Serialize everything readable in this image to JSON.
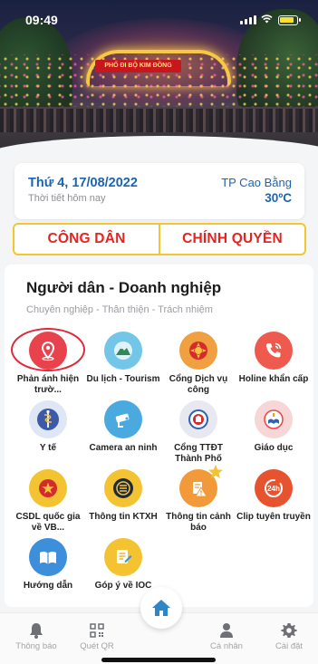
{
  "status_bar": {
    "time": "09:49"
  },
  "hero": {
    "sign_text": "PHỐ ĐI BỘ KIM ĐỒNG"
  },
  "weather": {
    "date": "Thứ 4, 17/08/2022",
    "subtitle": "Thời tiết hôm nay",
    "city": "TP Cao Bằng",
    "temperature": "30ºC"
  },
  "tabs": [
    {
      "label": "CÔNG DÂN"
    },
    {
      "label": "CHÍNH QUYỀN"
    }
  ],
  "section": {
    "title": "Người dân - Doanh nghiệp",
    "slogan": "Chuyên nghiệp - Thân thiện - Trách nhiệm"
  },
  "services": [
    {
      "label": "Phản ánh hiện trườ...",
      "icon": "location-pin-icon",
      "color": "#e8424c",
      "highlighted": true
    },
    {
      "label": "Du lịch - Tourism",
      "icon": "mountain-icon",
      "color": "#74c6e8"
    },
    {
      "label": "Cổng Dịch vụ công",
      "icon": "public-service-icon",
      "color": "#f0a040"
    },
    {
      "label": "Holine khẩn cấp",
      "icon": "phone-icon",
      "color": "#ef5a4f"
    },
    {
      "label": "Y tế",
      "icon": "medical-icon",
      "color": "#3c5aa8"
    },
    {
      "label": "Camera an ninh",
      "icon": "camera-icon",
      "color": "#4aa9de"
    },
    {
      "label": "Cổng TTĐT Thành Phố",
      "icon": "city-portal-icon",
      "color": "#e8e8f0"
    },
    {
      "label": "Giáo dục",
      "icon": "education-icon",
      "color": "#f6d6d6"
    },
    {
      "label": "CSDL quốc gia về VB...",
      "icon": "national-emblem-icon",
      "color": "#f3c331"
    },
    {
      "label": "Thông tin KTXH",
      "icon": "info-icon",
      "color": "#f3c331"
    },
    {
      "label": "Thông tin cảnh báo",
      "icon": "warning-icon",
      "color": "#f29a3a"
    },
    {
      "label": "Clip tuyên truyền",
      "icon": "clip-24h-icon",
      "color": "#e8532f"
    },
    {
      "label": "Hướng dẫn",
      "icon": "guide-book-icon",
      "color": "#3d8fdc"
    },
    {
      "label": "Góp ý về IOC",
      "icon": "feedback-icon",
      "color": "#f3c331"
    }
  ],
  "bottom_nav": [
    {
      "label": "Thông báo",
      "icon": "bell-icon"
    },
    {
      "label": "Quét QR",
      "icon": "qr-code-icon"
    },
    {
      "label": "",
      "icon": "home-icon"
    },
    {
      "label": "Cá nhân",
      "icon": "user-icon"
    },
    {
      "label": "Cài đặt",
      "icon": "settings-icon"
    }
  ],
  "colors": {
    "primary_blue": "#1b64b0",
    "tab_red": "#e52421",
    "tab_border": "#f3c531",
    "home_blue": "#2e86c9"
  }
}
